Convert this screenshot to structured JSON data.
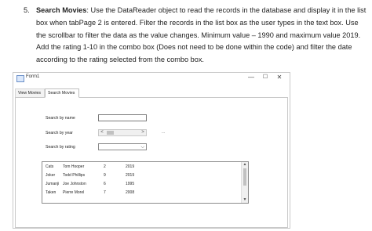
{
  "instructions": {
    "number": "5.",
    "heading": "Search Movies",
    "body": ": Use the DataReader object to read the records in the database and display it in the list box when tabPage 2 is entered. Filter the records in the list box as the user types in the text box. Use the scrollbar to filter the data as the value changes. Minimum value – 1990 and maximum value 2019. Add the rating 1-10 in the combo box (Does not need to be done within the code) and filter the date according to the rating selected from the combo box."
  },
  "window": {
    "title": "Form1",
    "minimize": "—",
    "maximize": "☐",
    "close": "✕"
  },
  "tabs": [
    {
      "label": "View Movies"
    },
    {
      "label": "Search Movies"
    }
  ],
  "search": {
    "name_label": "Search by name",
    "name_value": "",
    "year_label": "Search by year",
    "year_value_label": "...",
    "rating_label": "Search by rating",
    "rating_value": ""
  },
  "icons": {
    "scroll_left": "<",
    "scroll_right": ">",
    "combo_arrow": "⌵",
    "scroll_up": "▲",
    "scroll_down": "▼"
  },
  "movies": [
    {
      "title": "Cats",
      "name": "Tom Hooper",
      "rating": "2",
      "year": "2019"
    },
    {
      "title": "Joker",
      "name": "Todd Phillips",
      "rating": "9",
      "year": "2019"
    },
    {
      "title": "Jumanji",
      "name": "Joe Johnston",
      "rating": "6",
      "year": "1995"
    },
    {
      "title": "Taken",
      "name": "Pierre Morel",
      "rating": "7",
      "year": "2008"
    }
  ],
  "year_scrollbar": {
    "min": 1990,
    "max": 2019
  }
}
